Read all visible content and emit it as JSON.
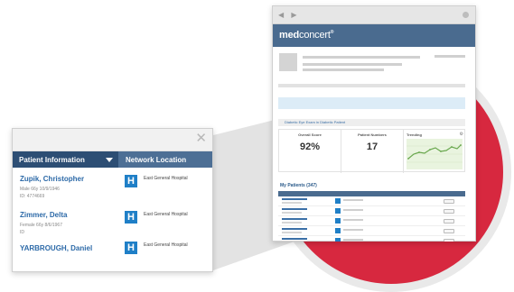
{
  "brand": {
    "logo_bold": "med",
    "logo_thin": "concert",
    "logo_mark": "®"
  },
  "browser": {
    "nav_arrows": "◀ ▶"
  },
  "dashboard": {
    "alert_text": "Diabetic Eye Exam in Diabetic Patient",
    "metrics": [
      {
        "title": "Overall Score",
        "value": "92%"
      },
      {
        "title": "Patient Numbers",
        "value": "17"
      }
    ],
    "trending_title": "Trending",
    "my_patients_title": "My Patients (347)"
  },
  "zoom": {
    "header_patient": "Patient Information",
    "header_location": "Network Location",
    "patients": [
      {
        "name": "Zupik, Christopher",
        "line1": "Male 66y 10/9/1946",
        "line2": "ID: 4774669",
        "location": "East General Hospital"
      },
      {
        "name": "Zimmer, Delta",
        "line1": "Female 66y 8/6/1967",
        "line2": "ID",
        "location": "East General Hospital"
      },
      {
        "name": "YARBROUGH, Daniel",
        "line1": "",
        "line2": "",
        "location": "East General Hospital"
      }
    ]
  },
  "colors": {
    "accent_red": "#d7283f",
    "brand_blue": "#2d4e74",
    "link_blue": "#2d6aa8",
    "hospital_icon": "#1f7fc7"
  }
}
